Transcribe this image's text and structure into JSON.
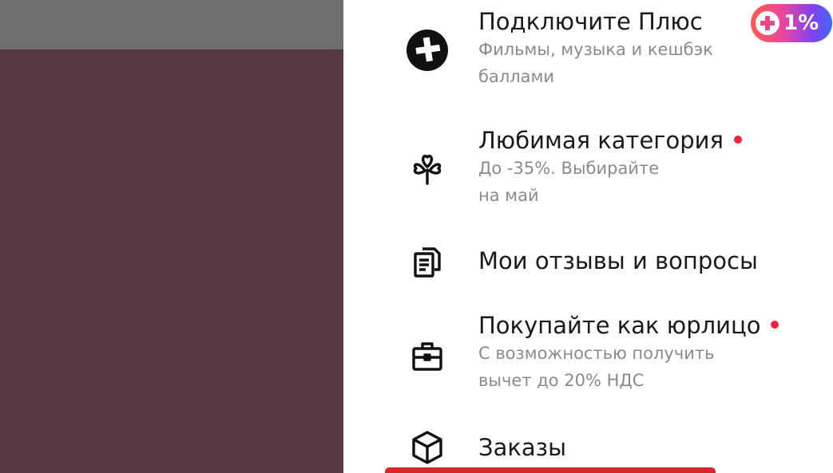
{
  "badge": {
    "label": "1%"
  },
  "menu": {
    "plus": {
      "title": "Подключите Плюс",
      "sub1": "Фильмы, музыка и кешбэк",
      "sub2": "баллами",
      "icon": "plus-logo-icon"
    },
    "favorite": {
      "title": "Любимая категория",
      "sub1": "До -35%. Выбирайте",
      "sub2": "на май",
      "icon": "hearts-clover-icon"
    },
    "reviews": {
      "title": "Мои отзывы и вопросы",
      "icon": "documents-icon"
    },
    "business": {
      "title": "Покупайте как юрлицо",
      "sub1": "С возможностью получить",
      "sub2": "вычет до 20% НДС",
      "icon": "briefcase-icon"
    },
    "orders": {
      "title": "Заказы",
      "icon": "box-icon"
    }
  },
  "colors": {
    "backdrop": "#573843",
    "backdrop_top": "#6e6e6e",
    "notification_dot": "#ff1f3d",
    "bottom_bar": "#d9262b"
  }
}
